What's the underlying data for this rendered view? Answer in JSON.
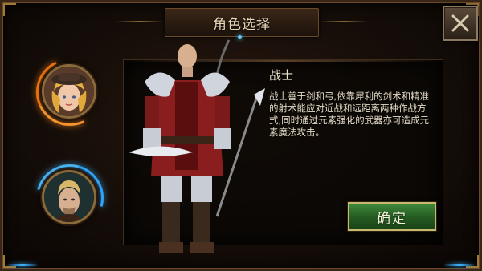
{
  "header": {
    "title": "角色选择"
  },
  "close_button": {
    "icon": "close-icon"
  },
  "character_list": [
    {
      "name": "female-character",
      "selected": false,
      "ring_color": "#ff7a10"
    },
    {
      "name": "male-character",
      "selected": true,
      "ring_color": "#30a8ff"
    }
  ],
  "selected_class": {
    "name": "战士",
    "description": "战士善于剑和弓,依靠犀利的剑术和精准的射术能应对近战和远距离两种作战方式,同时通过元素强化的武器亦可造成元素魔法攻击。"
  },
  "confirm_button": {
    "label": "确定",
    "color": "#2f7a2c"
  },
  "colors": {
    "accent_gold": "#a07a3a",
    "accent_blue": "#3fb4ff",
    "text": "#e6dcc8"
  }
}
